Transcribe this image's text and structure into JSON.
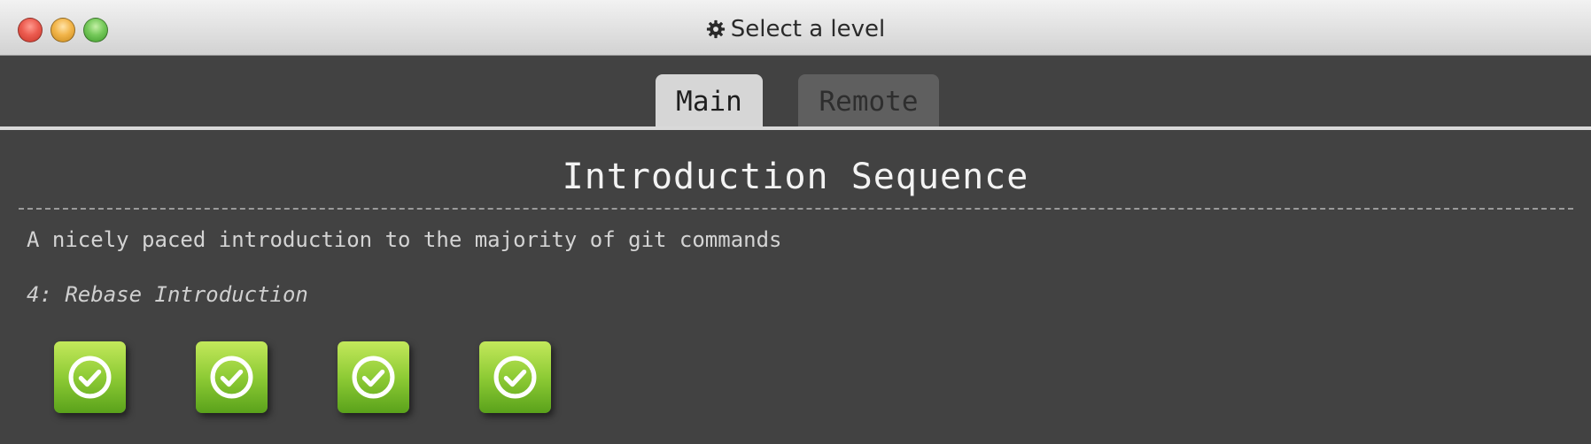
{
  "window": {
    "title": "Select a level",
    "title_icon": "gear-icon"
  },
  "tabs": [
    {
      "label": "Main",
      "selected": true
    },
    {
      "label": "Remote",
      "selected": false
    }
  ],
  "sequence": {
    "title": "Introduction Sequence",
    "about": "A nicely paced introduction to the majority of git commands",
    "selected_level": "4: Rebase Introduction",
    "levels": [
      {
        "status": "solved",
        "icon": "checkmark-circle-icon"
      },
      {
        "status": "solved",
        "icon": "checkmark-circle-icon"
      },
      {
        "status": "solved",
        "icon": "checkmark-circle-icon"
      },
      {
        "status": "solved",
        "icon": "checkmark-circle-icon"
      }
    ]
  },
  "colors": {
    "background": "#424242",
    "solved_level": "#8ecb35",
    "tab_selected": "#d6d6d6",
    "tab_unselected": "#5f5f5f"
  }
}
